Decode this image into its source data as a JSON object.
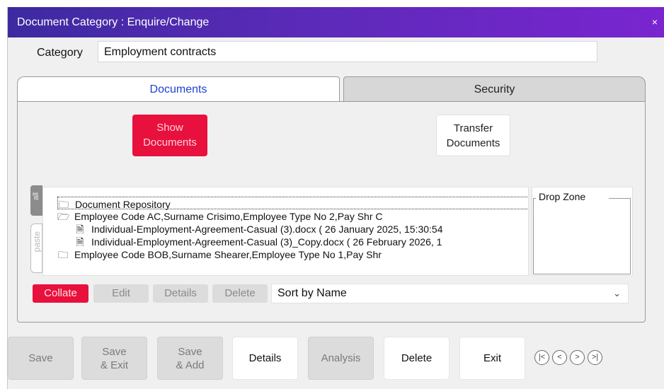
{
  "window": {
    "title": "Document Category : Enquire/Change",
    "close_glyph": "×"
  },
  "category": {
    "label": "Category",
    "value": "Employment contracts"
  },
  "tabs": [
    {
      "label": "Documents",
      "active": true
    },
    {
      "label": "Security",
      "active": false
    }
  ],
  "documents_panel": {
    "show_documents_label": "Show Documents",
    "transfer_documents_label": "Transfer Documents",
    "side_handle_label": "all",
    "paste_label": "paste",
    "tree": [
      {
        "icon": "folder-icon",
        "glyph": "🗀",
        "text": "Document Repository",
        "indent": 0,
        "selected": true
      },
      {
        "icon": "open-folder-icon",
        "glyph": "🗁",
        "text": "Employee Code AC,Surname Crisimo,Employee Type No 2,Pay Shr C",
        "indent": 0,
        "selected": false
      },
      {
        "icon": "document-icon",
        "glyph": "🗎",
        "text": "Individual-Employment-Agreement-Casual (3).docx   ( 26 January 2025, 15:30:54",
        "indent": 1,
        "selected": false
      },
      {
        "icon": "document-icon",
        "glyph": "🗎",
        "text": "Individual-Employment-Agreement-Casual (3)_Copy.docx   ( 26 February 2026, 1",
        "indent": 1,
        "selected": false
      },
      {
        "icon": "folder-icon",
        "glyph": "🗀",
        "text": "Employee Code BOB,Surname Shearer,Employee Type No 1,Pay Shr",
        "indent": 0,
        "selected": false
      }
    ],
    "drop_zone_label": "Drop Zone",
    "collate_label": "Collate",
    "edit_label": "Edit",
    "details_label": "Details",
    "delete_label": "Delete",
    "sort": {
      "value": "Sort by Name"
    }
  },
  "footer": {
    "save_label": "Save",
    "save_exit_line1": "Save",
    "save_exit_line2": "& Exit",
    "save_add_line1": "Save",
    "save_add_line2": "& Add",
    "details_label": "Details",
    "analysis_label": "Analysis",
    "delete_label": "Delete",
    "exit_label": "Exit"
  },
  "colors": {
    "title_gradient_start": "#3d2aa0",
    "title_gradient_end": "#7a25d0",
    "accent_red": "#e8103c",
    "active_tab_text": "#1f3fd6"
  }
}
